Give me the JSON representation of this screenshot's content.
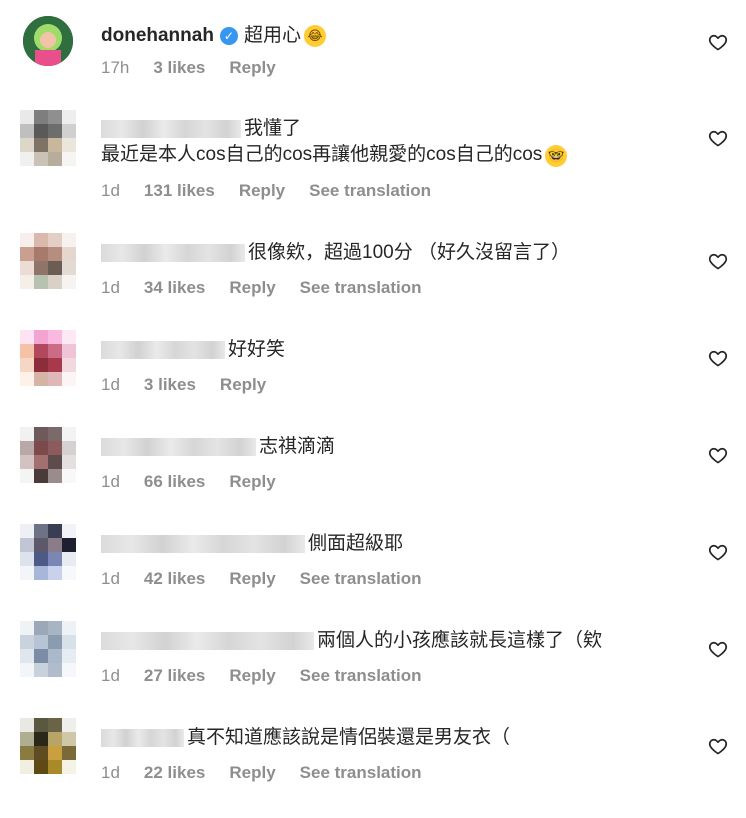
{
  "comments": [
    {
      "user": "donehannah",
      "verified": true,
      "text": "超用心",
      "emoji": "laughing-crying",
      "time": "17h",
      "likes": "3 likes",
      "reply": "Reply",
      "see_translation": ""
    },
    {
      "user": "",
      "text": "我懂了",
      "text2": "最近是本人cos自己的cos再讓他親愛的cos自己的cos",
      "emoji": "nerd-face",
      "time": "1d",
      "likes": "131 likes",
      "reply": "Reply",
      "see_translation": "See translation"
    },
    {
      "user": "",
      "text": "很像欸，超過100分 （好久沒留言了）",
      "time": "1d",
      "likes": "34 likes",
      "reply": "Reply",
      "see_translation": "See translation"
    },
    {
      "user": "",
      "text": "好好笑",
      "time": "1d",
      "likes": "3 likes",
      "reply": "Reply",
      "see_translation": ""
    },
    {
      "user": "",
      "text": "志祺滴滴",
      "time": "1d",
      "likes": "66 likes",
      "reply": "Reply",
      "see_translation": ""
    },
    {
      "user": "",
      "text": "側面超級耶",
      "time": "1d",
      "likes": "42 likes",
      "reply": "Reply",
      "see_translation": "See translation"
    },
    {
      "user": "",
      "text": "兩個人的小孩應該就長這樣了（欸",
      "time": "1d",
      "likes": "27 likes",
      "reply": "Reply",
      "see_translation": "See translation"
    },
    {
      "user": "",
      "text": "真不知道應該說是情侶裝還是男友衣（",
      "time": "1d",
      "likes": "22 likes",
      "reply": "Reply",
      "see_translation": "See translation"
    }
  ],
  "icons": {
    "like": "heart-outline-icon",
    "verified": "verified-badge-icon"
  },
  "colors": {
    "text": "#262626",
    "meta": "#8e8e8e",
    "verified": "#3797f0"
  }
}
